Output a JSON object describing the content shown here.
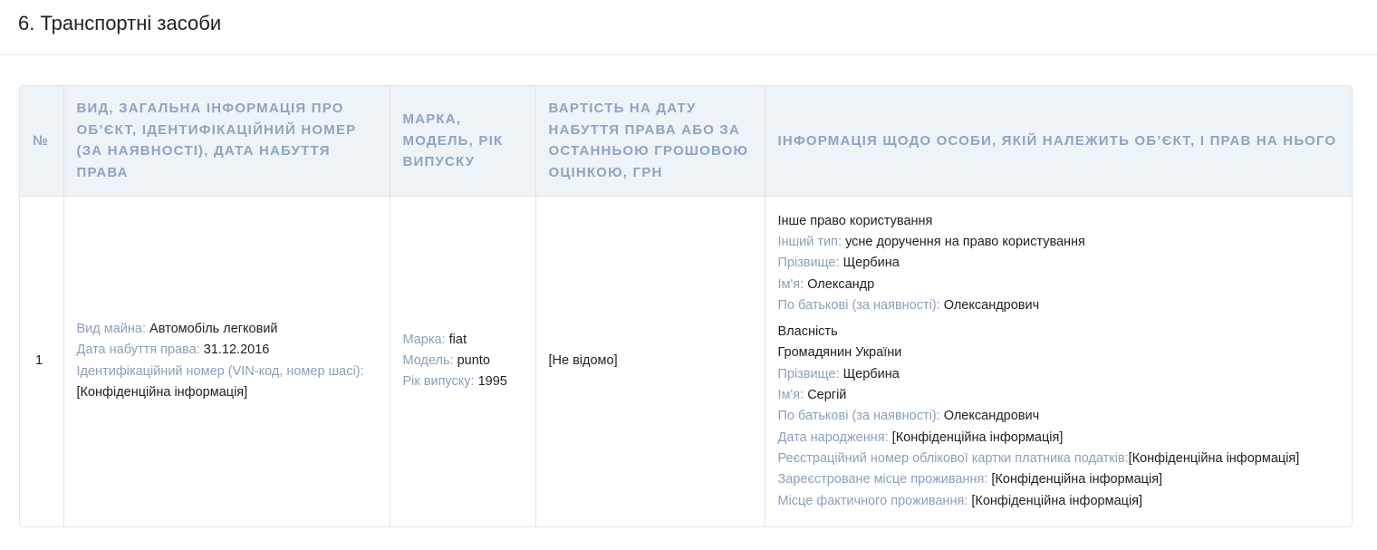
{
  "section": {
    "title": "6. Транспортні засоби"
  },
  "table": {
    "headers": {
      "num": "№",
      "object": "Вид, загальна інформація про об’єкт, ідентифікаційний номер (за наявності), дата набуття права",
      "brand": "Марка, модель, рік випуску",
      "value": "Вартість на дату набуття права або за останньою грошовою оцінкою, грн",
      "owner": "Інформація щодо особи, якій належить об’єкт, і прав на нього"
    },
    "rows": [
      {
        "num": "1",
        "object": {
          "property_type_label": "Вид майна:",
          "property_type_value": "Автомобіль легковий",
          "acquired_label": "Дата набуття права:",
          "acquired_value": "31.12.2016",
          "vin_label": "Ідентифікаційний номер (VIN-код, номер шасі):",
          "vin_value": "[Конфіденційна інформація]"
        },
        "brand": {
          "make_label": "Марка:",
          "make_value": "fiat",
          "model_label": "Модель:",
          "model_value": "punto",
          "year_label": "Рік випуску:",
          "year_value": "1995"
        },
        "value": "[Не відомо]",
        "owners": [
          {
            "right_type": "Інше право користування",
            "other_type_label": "Інший тип:",
            "other_type_value": "усне доручення на право користування",
            "surname_label": "Прізвище:",
            "surname_value": "Щербина",
            "name_label": "Ім'я:",
            "name_value": "Олександр",
            "patronymic_label": "По батькові (за наявності):",
            "patronymic_value": "Олександрович"
          },
          {
            "right_type": "Власність",
            "citizenship": "Громадянин України",
            "surname_label": "Прізвище:",
            "surname_value": "Щербина",
            "name_label": "Ім'я:",
            "name_value": "Сергій",
            "patronymic_label": "По батькові (за наявності):",
            "patronymic_value": "Олександрович",
            "birth_label": "Дата народження:",
            "birth_value": "[Конфіденційна інформація]",
            "taxid_label": "Реєстраційний номер облікової картки платника податків:",
            "taxid_value": "[Конфіденційна інформація]",
            "registered_label": "Зареєстроване місце проживання:",
            "registered_value": "[Конфіденційна інформація]",
            "actual_label": "Місце фактичного проживання:",
            "actual_value": "[Конфіденційна інформація]"
          }
        ]
      }
    ]
  }
}
